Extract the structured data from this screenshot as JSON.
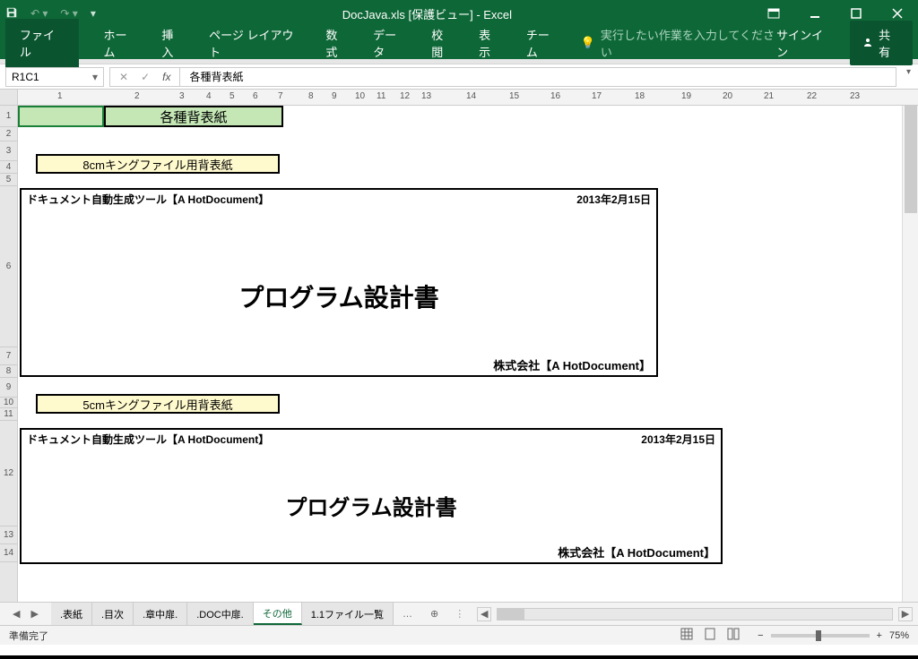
{
  "titlebar": {
    "title": "DocJava.xls  [保護ビュー] - Excel"
  },
  "ribbon": {
    "file": "ファイル",
    "tabs": [
      "ホーム",
      "挿入",
      "ページ レイアウト",
      "数式",
      "データ",
      "校閲",
      "表示",
      "チーム"
    ],
    "tell": "実行したい作業を入力してください",
    "signin": "サインイン",
    "share": "共有"
  },
  "formula": {
    "cellref": "R1C1",
    "value": "各種背表紙"
  },
  "ruler_ticks": [
    1,
    2,
    3,
    4,
    5,
    6,
    7,
    8,
    9,
    10,
    11,
    12,
    13,
    14,
    15,
    16,
    17,
    18,
    19,
    20,
    21,
    22,
    23
  ],
  "sheet": {
    "heading": "各種背表紙",
    "label1": "8cmキングファイル用背表紙",
    "label2": "5cmキングファイル用背表紙",
    "box1": {
      "tool": "ドキュメント自動生成ツール【A HotDocument】",
      "date": "2013年2月15日",
      "title": "プログラム設計書",
      "company": "株式会社【A HotDocument】"
    },
    "box2": {
      "tool": "ドキュメント自動生成ツール【A HotDocument】",
      "date": "2013年2月15日",
      "title": "プログラム設計書",
      "company": "株式会社【A HotDocument】"
    }
  },
  "sheettabs": {
    "tabs": [
      ".表紙",
      ".目次",
      ".章中扉.",
      ".DOC中扉.",
      "その他",
      "1.1ファイル一覧"
    ],
    "active_index": 4,
    "more": "…"
  },
  "status": {
    "ready": "準備完了",
    "zoom": "75%"
  }
}
